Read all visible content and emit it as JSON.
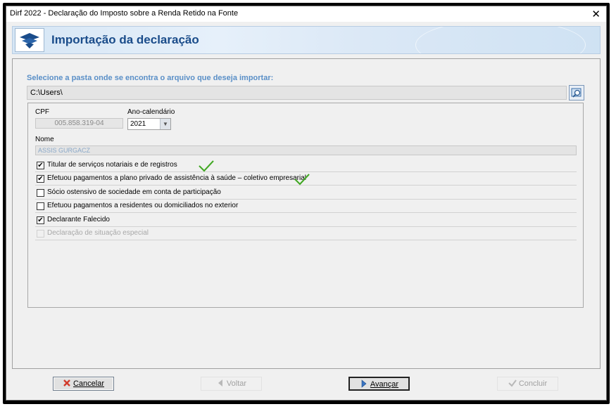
{
  "window": {
    "title": "Dirf 2022 - Declaração do Imposto sobre a Renda Retido na Fonte",
    "close_symbol": "✕"
  },
  "header": {
    "title": "Importação da declaração",
    "logo": "receita-federal-logo"
  },
  "folder": {
    "prompt": "Selecione a pasta onde se encontra o arquivo que deseja importar:",
    "path": "C:\\Users\\",
    "browse_icon": "folder-search-icon"
  },
  "form": {
    "cpf_label": "CPF",
    "cpf_value": "005.858.319-04",
    "year_label": "Ano-calendário",
    "year_value": "2021",
    "name_label": "Nome",
    "name_value": "ASSIS GURGACZ"
  },
  "options": [
    {
      "label": "Titular de serviços notariais e de registros",
      "checked": true,
      "disabled": false
    },
    {
      "label": "Efetuou pagamentos a plano privado de assistência à saúde – coletivo empresarial",
      "checked": true,
      "disabled": false
    },
    {
      "label": "Sócio ostensivo de sociedade em conta de participação",
      "checked": false,
      "disabled": false
    },
    {
      "label": "Efetuou pagamentos a residentes ou domiciliados no exterior",
      "checked": false,
      "disabled": false
    },
    {
      "label": "Declarante Falecido",
      "checked": true,
      "disabled": false
    },
    {
      "label": "Declaração de situação especial",
      "checked": false,
      "disabled": true
    }
  ],
  "buttons": {
    "cancel": "Cancelar",
    "back": "Voltar",
    "next": "Avançar",
    "finish": "Concluir"
  },
  "colors": {
    "accent": "#1a4c8a",
    "prompt": "#5a8fc7",
    "check_mark": "#5cc23a"
  }
}
